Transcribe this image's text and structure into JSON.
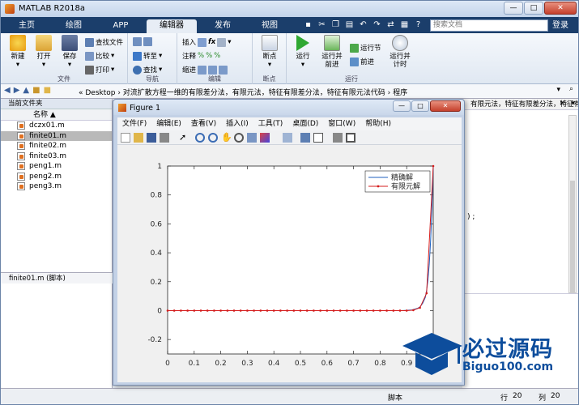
{
  "app": {
    "title": "MATLAB R2018a",
    "window_buttons": [
      "—",
      "□",
      "✕"
    ]
  },
  "tabs": [
    "主页",
    "绘图",
    "APP",
    "编辑器",
    "发布",
    "视图"
  ],
  "active_tab": "编辑器",
  "search_placeholder": "搜索文档",
  "login": "登录",
  "ribbon": {
    "file": {
      "label": "文件",
      "new": "新建",
      "open": "打开",
      "save": "保存",
      "find_files": "查找文件",
      "compare": "比较",
      "print": "打印"
    },
    "nav": {
      "label": "导航",
      "goto": "转至",
      "find": "查找"
    },
    "edit": {
      "label": "编辑",
      "insert": "插入",
      "comment": "注释",
      "indent": "缩进"
    },
    "breakpoints": {
      "label": "断点",
      "breakpoints": "断点"
    },
    "run": {
      "label": "运行",
      "run": "运行",
      "run_advance_l1": "运行并",
      "run_advance_l2": "前进",
      "run_section": "运行节",
      "advance": "前进",
      "run_time_l1": "运行并",
      "run_time_l2": "计时"
    }
  },
  "address": {
    "path": "«  Desktop  ›  对流扩散方程一维的有限差分法，有限元法，特征有限差分法，特征有限元法代码  ›  程序"
  },
  "current_folder": {
    "title": "当前文件夹",
    "col_name": "名称 ▲",
    "files": [
      "dczx01.m",
      "finite01.m",
      "finite02.m",
      "finite03.m",
      "peng1.m",
      "peng2.m",
      "peng3.m"
    ],
    "selected": 1,
    "details": "finite01.m  (脚本)"
  },
  "editor_right": {
    "tab_text": "有限元法，特征有限差分法，特征有限…",
    "code_fragment": ") ;"
  },
  "figure": {
    "title": "Figure 1",
    "menu": [
      "文件(F)",
      "编辑(E)",
      "查看(V)",
      "插入(I)",
      "工具(T)",
      "桌面(D)",
      "窗口(W)",
      "帮助(H)"
    ]
  },
  "chart_data": {
    "type": "line",
    "title": "",
    "xlabel": "",
    "ylabel": "",
    "xlim": [
      0,
      1
    ],
    "ylim": [
      -0.3,
      1
    ],
    "xticks": [
      "0",
      "0.1",
      "0.2",
      "0.3",
      "0.4",
      "0.5",
      "0.6",
      "0.7",
      "0.8",
      "0.9"
    ],
    "yticks": [
      "1",
      "0.8",
      "0.6",
      "0.4",
      "0.2",
      "0",
      "-0.2"
    ],
    "legend_position": "top-right",
    "series": [
      {
        "name": "精确解",
        "color": "#1f5fbf",
        "marker": "none",
        "x": [
          0,
          0.85,
          0.88,
          0.9,
          0.92,
          0.94,
          0.95,
          0.96,
          0.97,
          0.975,
          0.98,
          0.985,
          0.99,
          0.995,
          1.0
        ],
        "y": [
          0,
          0,
          0,
          0.002,
          0.005,
          0.015,
          0.025,
          0.05,
          0.09,
          0.14,
          0.21,
          0.32,
          0.48,
          0.7,
          1.0
        ]
      },
      {
        "name": "有限元解",
        "color": "#d41c1c",
        "marker": "dot",
        "x": [
          0,
          0.025,
          0.05,
          0.075,
          0.1,
          0.125,
          0.15,
          0.175,
          0.2,
          0.225,
          0.25,
          0.275,
          0.3,
          0.325,
          0.35,
          0.375,
          0.4,
          0.425,
          0.45,
          0.475,
          0.5,
          0.525,
          0.55,
          0.575,
          0.6,
          0.625,
          0.65,
          0.675,
          0.7,
          0.725,
          0.75,
          0.775,
          0.8,
          0.825,
          0.85,
          0.875,
          0.9,
          0.925,
          0.95,
          0.975,
          1.0
        ],
        "y": [
          0,
          0,
          0,
          0,
          0,
          0,
          0,
          0,
          0,
          0,
          0,
          0,
          0,
          0,
          0,
          0,
          0,
          0,
          0,
          0,
          0,
          0,
          0,
          0,
          0,
          0,
          0,
          0,
          0,
          0,
          0,
          0,
          0,
          0,
          0,
          0,
          0,
          0.003,
          0.02,
          0.12,
          1.0
        ]
      }
    ]
  },
  "statusbar": {
    "type": "脚本",
    "row_label": "行",
    "row": "20",
    "col_label": "列",
    "col": "20"
  },
  "watermark": {
    "brand": "必过源码",
    "url": "Biguo100.com"
  }
}
